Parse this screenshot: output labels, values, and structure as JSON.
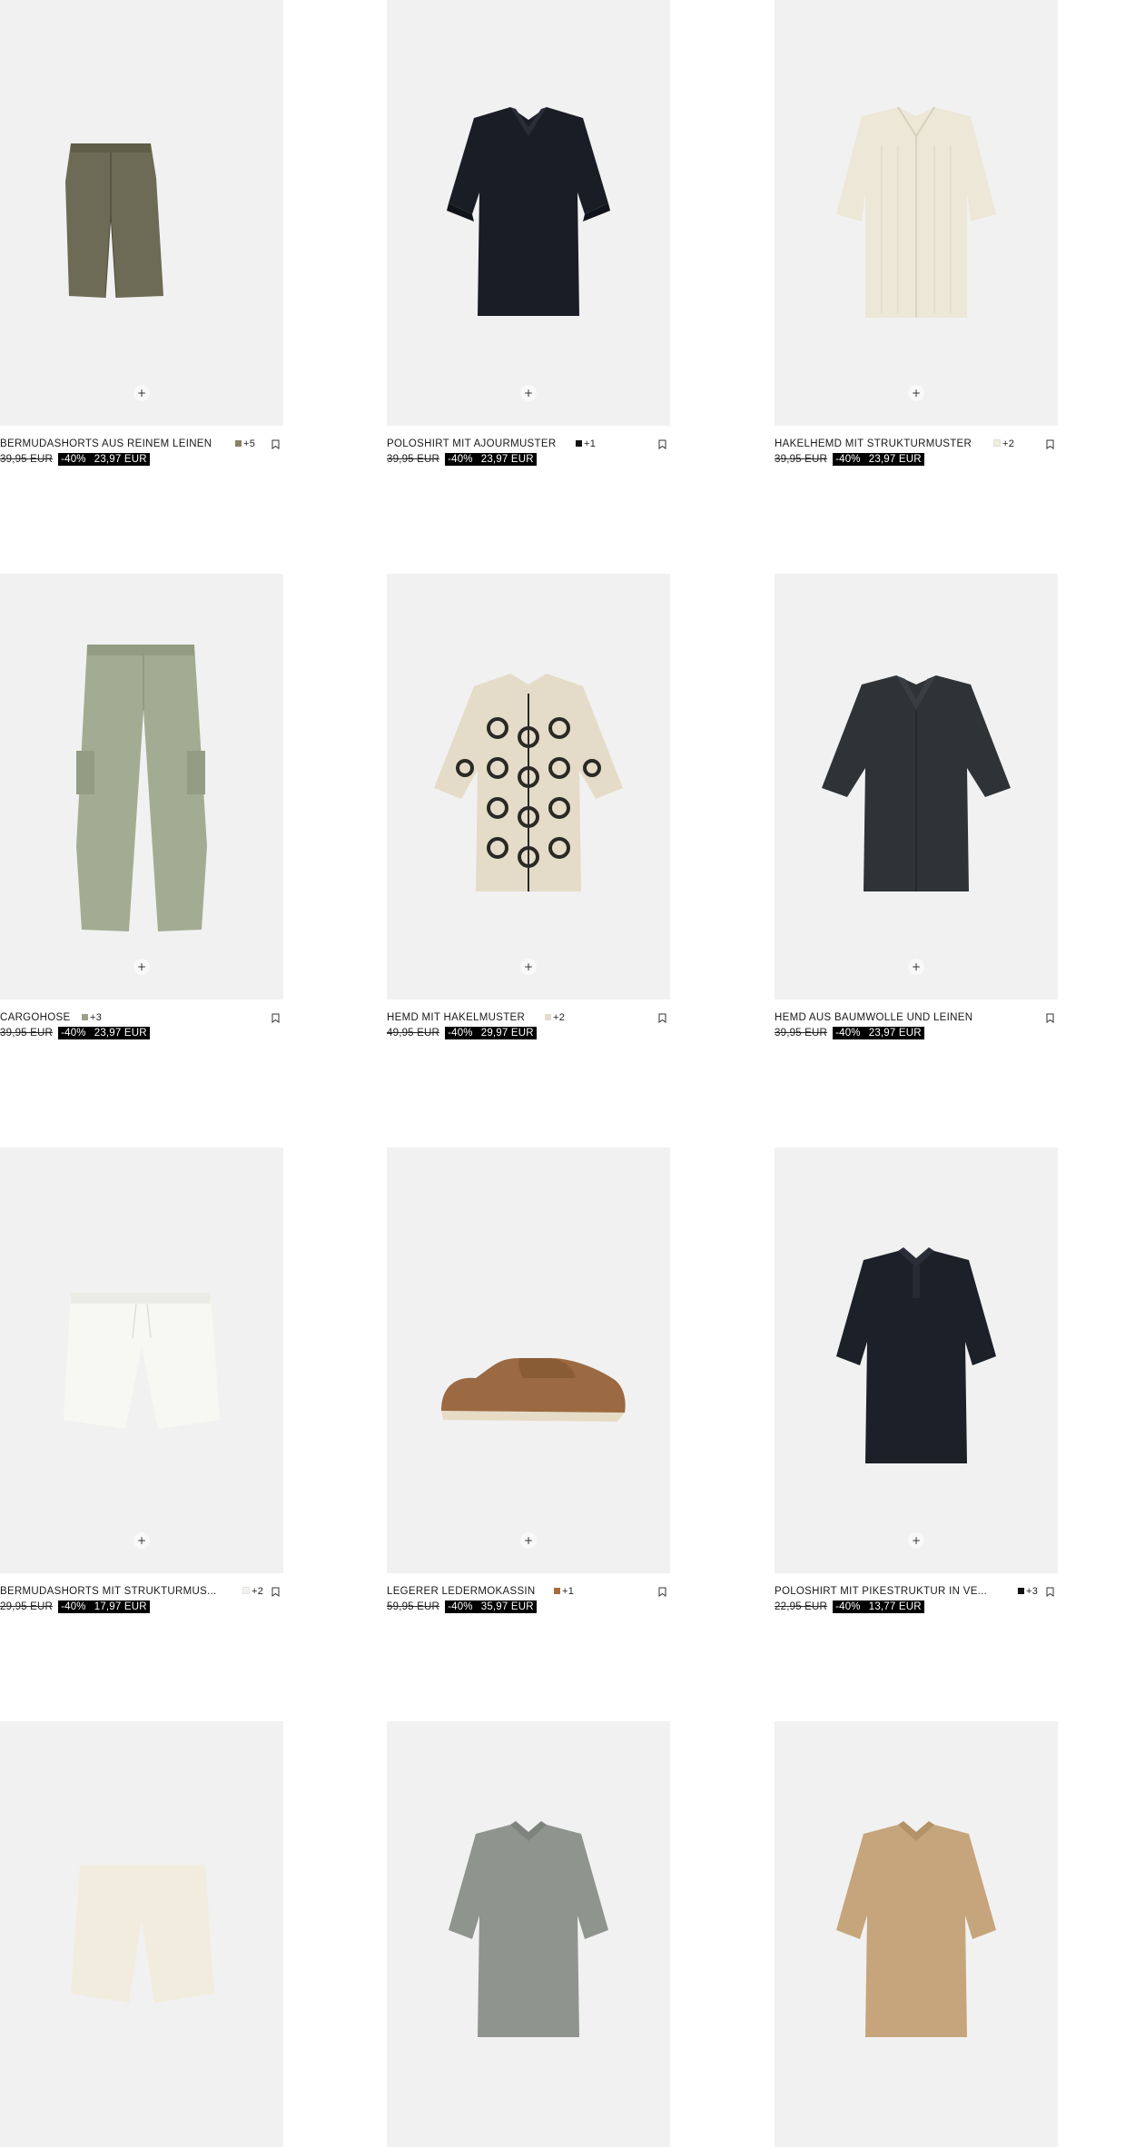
{
  "quick_add_symbol": "+",
  "products": [
    {
      "name": "BERMUDASHORTS AUS REINEM LEINEN",
      "swatch": "#8a8069",
      "more": "+5",
      "old_price": "39,95 EUR",
      "discount": "-40%",
      "price": "23,97 EUR",
      "image": "khaki-shorts"
    },
    {
      "name": "POLOSHIRT MIT AJOURMUSTER",
      "swatch": "#111111",
      "more": "+1",
      "old_price": "39,95 EUR",
      "discount": "-40%",
      "price": "23,97 EUR",
      "image": "navy-polo-knit"
    },
    {
      "name": "HÄKELHEMD MIT STRUKTURMUSTER",
      "swatch": "#f1ece0",
      "more": "+2",
      "old_price": "39,95 EUR",
      "discount": "-40%",
      "price": "23,97 EUR",
      "image": "cream-crochet-shirt"
    },
    {
      "name": "CARGOHOSE",
      "swatch": "#9aa08a",
      "more": "+3",
      "old_price": "39,95 EUR",
      "discount": "-40%",
      "price": "23,97 EUR",
      "image": "green-cargo-pants"
    },
    {
      "name": "HEMD MIT HÄKELMUSTER",
      "swatch": "#e3ddcd",
      "more": "+2",
      "old_price": "49,95 EUR",
      "discount": "-40%",
      "price": "29,97 EUR",
      "image": "patterned-crochet-shirt"
    },
    {
      "name": "HEMD AUS BAUMWOLLE UND LEINEN",
      "swatch": "",
      "more": "",
      "old_price": "39,95 EUR",
      "discount": "-40%",
      "price": "23,97 EUR",
      "image": "charcoal-shirt"
    },
    {
      "name": "BERMUDASHORTS MIT STRUKTURMUS...",
      "swatch": "#f2f2ee",
      "more": "+2",
      "old_price": "29,95 EUR",
      "discount": "-40%",
      "price": "17,97 EUR",
      "image": "white-shorts"
    },
    {
      "name": "LEGERER LEDERMOKASSIN",
      "swatch": "#a86b3c",
      "more": "+1",
      "old_price": "59,95 EUR",
      "discount": "-40%",
      "price": "35,97 EUR",
      "image": "brown-loafer"
    },
    {
      "name": "POLOSHIRT MIT PIKÉSTRUKTUR IN VE...",
      "swatch": "#111111",
      "more": "+3",
      "old_price": "22,95 EUR",
      "discount": "-40%",
      "price": "13,77 EUR",
      "image": "navy-pique-polo"
    },
    {
      "name": "",
      "swatch": "",
      "more": "",
      "old_price": "",
      "discount": "",
      "price": "",
      "image": "cream-shorts-partial"
    },
    {
      "name": "",
      "swatch": "",
      "more": "",
      "old_price": "",
      "discount": "",
      "price": "",
      "image": "grey-zip-polo-partial"
    },
    {
      "name": "",
      "swatch": "",
      "more": "",
      "old_price": "",
      "discount": "",
      "price": "",
      "image": "tan-polo-partial"
    }
  ]
}
